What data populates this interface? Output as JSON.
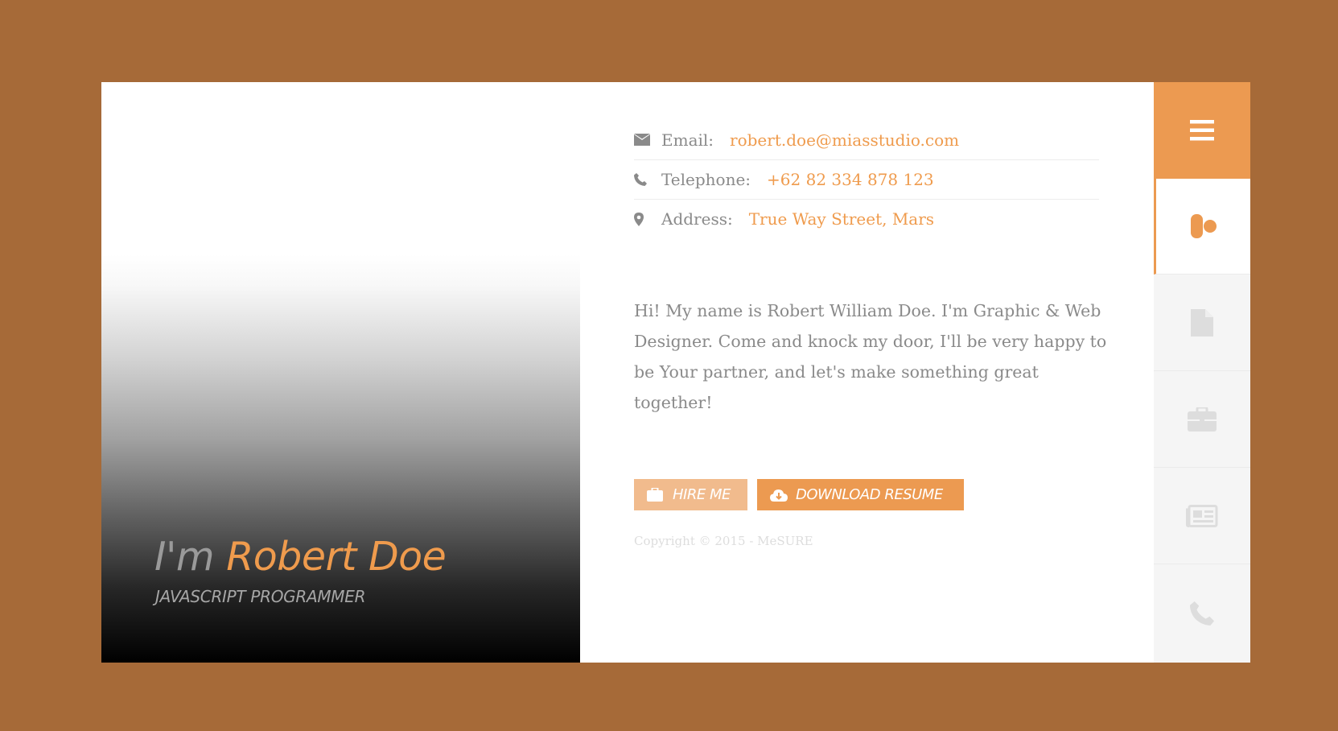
{
  "profile": {
    "greeting": "I'm",
    "name": "Robert Doe",
    "role": "JAVASCRIPT PROGRAMMER"
  },
  "contact": [
    {
      "label": "Email:",
      "value": "robert.doe@miasstudio.com",
      "icon": "envelope-icon"
    },
    {
      "label": "Telephone:",
      "value": "+62 82 334 878 123",
      "icon": "phone-icon"
    },
    {
      "label": "Address:",
      "value": "True Way Street, Mars",
      "icon": "map-marker-icon"
    }
  ],
  "about": "Hi! My name is Robert William Doe. I'm Graphic & Web Designer. Come and knock my door, I'll be very happy to be Your partner, and let's make something great together!",
  "buttons": {
    "hire": "HIRE ME",
    "download": "DOWNLOAD RESUME"
  },
  "copyright": "Copyright © 2015 - MeSURE",
  "nav": [
    {
      "icon": "menu-icon",
      "active": false
    },
    {
      "icon": "user-icon",
      "active": true
    },
    {
      "icon": "document-icon",
      "active": false
    },
    {
      "icon": "briefcase-icon",
      "active": false
    },
    {
      "icon": "newspaper-icon",
      "active": false
    },
    {
      "icon": "phone-icon",
      "active": false
    }
  ],
  "colors": {
    "background": "#a66a38",
    "accent": "#ec9a51",
    "accent_light": "#f1bb8d",
    "text_muted": "#8a8a8a"
  }
}
